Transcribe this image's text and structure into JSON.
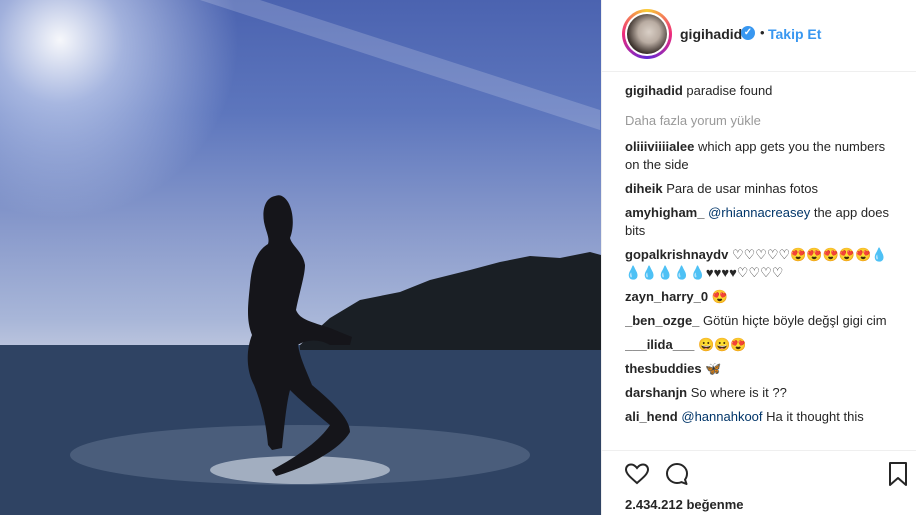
{
  "post": {
    "username": "gigihadid",
    "verified_mark": "✓",
    "dot": "•",
    "follow_label": "Takip Et"
  },
  "comments": {
    "caption": {
      "user": "gigihadid",
      "text": "paradise found"
    },
    "load_more": "Daha fazla yorum yükle",
    "items": [
      {
        "user": "oliiiviiiialee",
        "text": "which app gets you the numbers on the side"
      },
      {
        "user": "diheik",
        "text": "Para de usar minhas fotos"
      },
      {
        "user": "amyhigham_",
        "mention": "@rhiannacreasey",
        "text": "the app does bits"
      },
      {
        "user": "gopalkrishnaydv",
        "text": "♡♡♡♡♡😍😍😍😍😍💧💧💧💧💧💧♥♥♥♥♡♡♡♡"
      },
      {
        "user": "zayn_harry_0",
        "text": "😍"
      },
      {
        "user": "_ben_ozge_",
        "text": "Götün hiçte böyle değşl gigi cim"
      },
      {
        "user": "___ilida___",
        "text": "😀😀😍"
      },
      {
        "user": "thesbuddies",
        "text": "🦋"
      },
      {
        "user": "darshanjn",
        "text": "So where is it ??"
      },
      {
        "user": "ali_hend",
        "mention": "@hannahkoof",
        "text": "Ha it thought this"
      }
    ]
  },
  "actions": {
    "like_icon": "heart-outline-icon",
    "comment_icon": "comment-bubble-icon",
    "save_icon": "bookmark-icon",
    "likes_label": "2.434.212 beğenme"
  },
  "colors": {
    "link": "#3897f0",
    "text": "#262626",
    "muted": "#999999"
  }
}
